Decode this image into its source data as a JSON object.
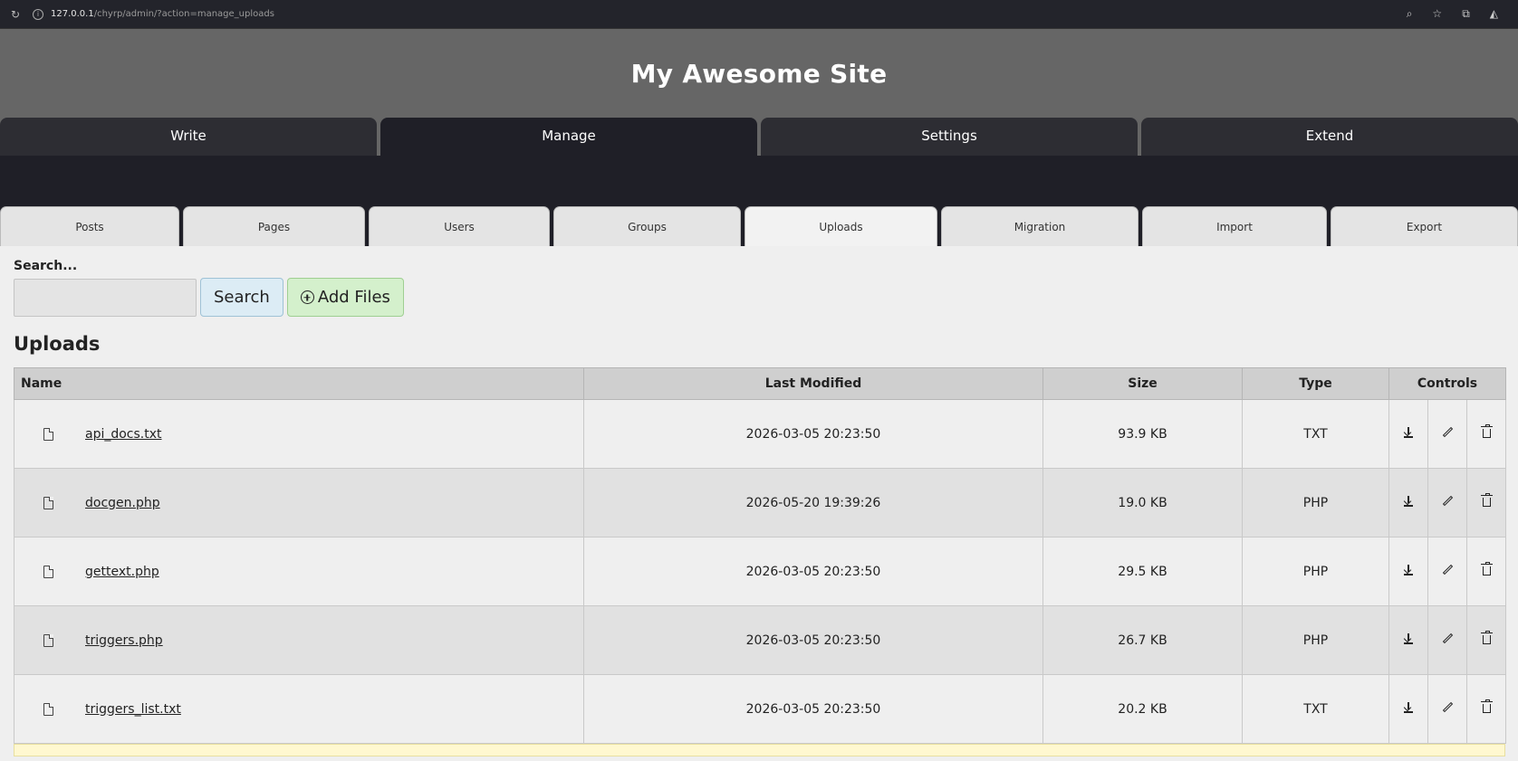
{
  "browser": {
    "url_host": "127.0.0.1",
    "url_path": "/chyrp/admin/?action=manage_uploads"
  },
  "site": {
    "title": "My Awesome Site"
  },
  "main_tabs": [
    {
      "label": "Write"
    },
    {
      "label": "Manage"
    },
    {
      "label": "Settings"
    },
    {
      "label": "Extend"
    }
  ],
  "sub_tabs": [
    {
      "label": "Posts"
    },
    {
      "label": "Pages"
    },
    {
      "label": "Users"
    },
    {
      "label": "Groups"
    },
    {
      "label": "Uploads"
    },
    {
      "label": "Migration"
    },
    {
      "label": "Import"
    },
    {
      "label": "Export"
    }
  ],
  "search": {
    "label": "Search...",
    "value": "",
    "search_button": "Search",
    "add_button": "Add Files"
  },
  "uploads": {
    "title": "Uploads",
    "columns": {
      "name": "Name",
      "modified": "Last Modified",
      "size": "Size",
      "type": "Type",
      "controls": "Controls"
    },
    "rows": [
      {
        "name": "api_docs.txt",
        "modified": "2026-03-05 20:23:50",
        "size": "93.9 KB",
        "type": "TXT"
      },
      {
        "name": "docgen.php",
        "modified": "2026-05-20 19:39:26",
        "size": "19.0 KB",
        "type": "PHP"
      },
      {
        "name": "gettext.php",
        "modified": "2026-03-05 20:23:50",
        "size": "29.5 KB",
        "type": "PHP"
      },
      {
        "name": "triggers.php",
        "modified": "2026-03-05 20:23:50",
        "size": "26.7 KB",
        "type": "PHP"
      },
      {
        "name": "triggers_list.txt",
        "modified": "2026-03-05 20:23:50",
        "size": "20.2 KB",
        "type": "TXT"
      }
    ]
  }
}
